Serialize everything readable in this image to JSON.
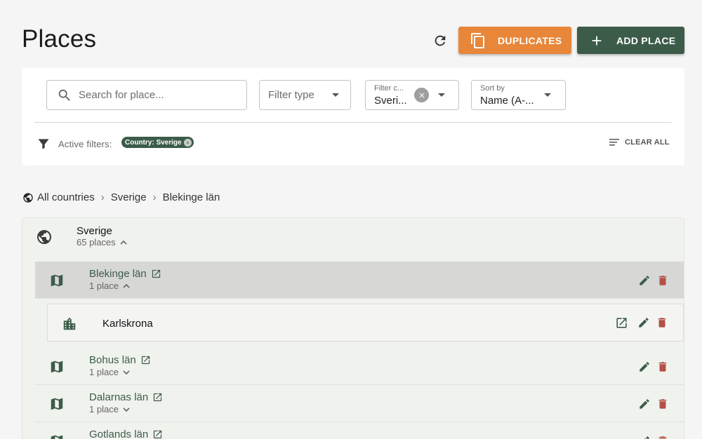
{
  "header": {
    "title": "Places",
    "duplicates_label": "DUPLICATES",
    "add_place_label": "ADD PLACE"
  },
  "filters": {
    "search_placeholder": "Search for place...",
    "type_label": "Filter type",
    "country_label": "Filter c...",
    "country_value": "Sveri...",
    "sort_label": "Sort by",
    "sort_value": "Name (A-...",
    "active_filters_label": "Active filters:",
    "active_chip": "Country: Sverige",
    "clear_all_label": "CLEAR ALL"
  },
  "breadcrumb": [
    "All countries",
    "Sverige",
    "Blekinge län"
  ],
  "tree": {
    "country": {
      "name": "Sverige",
      "count": "65 places"
    },
    "regions": [
      {
        "name": "Blekinge län",
        "count": "1 place",
        "expanded": true
      },
      {
        "name": "Bohus län",
        "count": "1 place",
        "expanded": false
      },
      {
        "name": "Dalarnas län",
        "count": "1 place",
        "expanded": false
      },
      {
        "name": "Gotlands län",
        "count": "",
        "expanded": false
      }
    ],
    "place": {
      "name": "Karlskrona"
    }
  },
  "colors": {
    "primary": "#3c5c49",
    "accent": "#e8863a",
    "delete": "#b55048"
  },
  "icons": [
    "refresh-icon",
    "copy-icon",
    "plus-icon",
    "search-icon",
    "filter-icon",
    "globe-icon",
    "map-icon",
    "city-icon",
    "open-in-new-icon",
    "pencil-icon",
    "trash-icon"
  ]
}
